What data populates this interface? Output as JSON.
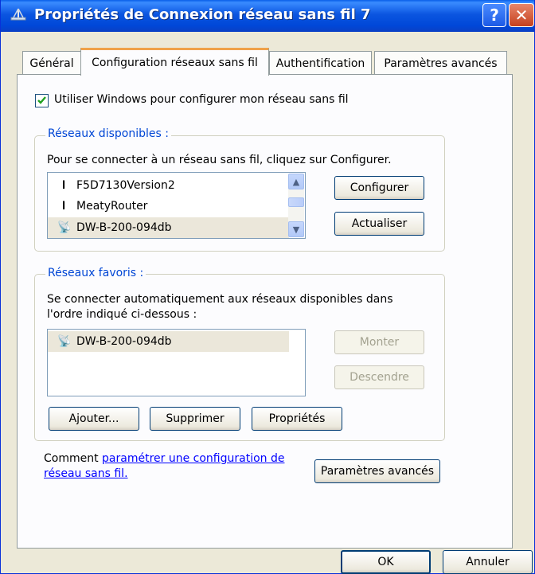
{
  "window": {
    "title": "Propriétés de Connexion réseau sans fil 7",
    "help_label": "?",
    "close_label": "✕"
  },
  "tabs": [
    {
      "label": "Général"
    },
    {
      "label": "Configuration réseaux sans fil"
    },
    {
      "label": "Authentification"
    },
    {
      "label": "Paramètres avancés"
    }
  ],
  "use_windows_checkbox": {
    "label": "Utiliser Windows pour configurer mon réseau sans fil",
    "checked": true
  },
  "available": {
    "legend": "Réseaux disponibles :",
    "description": "Pour se connecter à un réseau sans fil, cliquez sur Configurer.",
    "networks": [
      {
        "name": "F5D7130Version2",
        "icon": "antenna-icon"
      },
      {
        "name": "MeatyRouter",
        "icon": "antenna-icon"
      },
      {
        "name": "DW-B-200-094db",
        "icon": "wireless-signal-icon",
        "selected": true
      }
    ],
    "configure_label": "Configurer",
    "refresh_label": "Actualiser"
  },
  "preferred": {
    "legend": "Réseaux favoris :",
    "description_line1": "Se connecter automatiquement aux réseaux disponibles dans",
    "description_line2": "l'ordre indiqué ci-dessous :",
    "networks": [
      {
        "name": "DW-B-200-094db",
        "icon": "wireless-signal-icon"
      }
    ],
    "up_label": "Monter",
    "down_label": "Descendre",
    "add_label": "Ajouter...",
    "remove_label": "Supprimer",
    "properties_label": "Propriétés"
  },
  "footer": {
    "text_prefix": "Comment ",
    "link_line1": "paramétrer une configuration de",
    "link_line2": "réseau sans fil.",
    "advanced_label": "Paramètres avancés"
  },
  "dialog": {
    "ok_label": "OK",
    "cancel_label": "Annuler"
  }
}
